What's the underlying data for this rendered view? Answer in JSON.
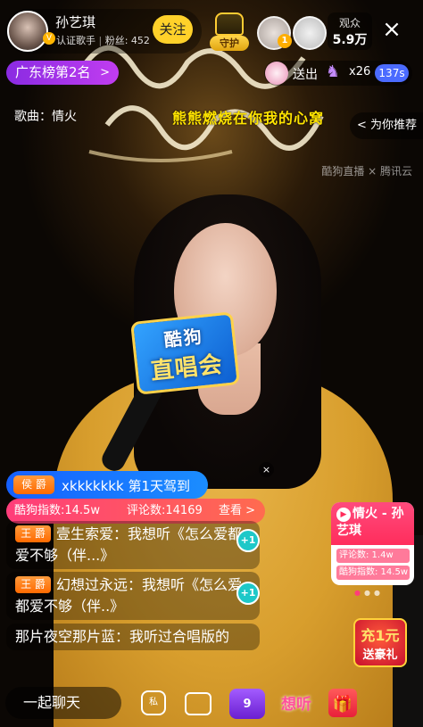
{
  "anchor": {
    "name": "孙艺琪",
    "title": "认证歌手",
    "fans": "粉丝: 452",
    "follow_label": "关注",
    "verified_badge": "V"
  },
  "guard": {
    "label": "守护"
  },
  "fan_rank": {
    "top_rank": "1"
  },
  "viewers": {
    "label": "观众",
    "count": "5.9万"
  },
  "close_icon": "×",
  "rank_badge": {
    "label": "广东榜第2名",
    "arrow": ">"
  },
  "gift_bar": {
    "send_label": "送出",
    "count": "x26",
    "timer": "137s"
  },
  "song": {
    "label": "歌曲：情火",
    "lyric": "熊熊燃烧在你我的心窝"
  },
  "recommend": {
    "label": "< 为你推荐"
  },
  "watermark": "酷狗直播 × 腾讯云",
  "mic_flag": {
    "line1": "酷狗",
    "line2": "直唱会"
  },
  "entry_banner": {
    "tag": "侯 爵",
    "text": "xkkkkkkk 第1天驾到"
  },
  "song_card": {
    "index_label": "酷狗指数:14.5w",
    "comments_label": "评论数:14169",
    "view_label": "查看 >",
    "close_label": "×"
  },
  "chat": [
    {
      "tag": "王 爵",
      "text": "壹生索爱：我想听《怎么爱都爱不够（伴...》"
    },
    {
      "tag": "王 爵",
      "text": "幻想过永远：我想听《怎么爱都爱不够（伴..》"
    },
    {
      "tag": "",
      "text": "那片夜空那片蓝：我听过合唱版的"
    }
  ],
  "plus_one_label": "+1",
  "side_card": {
    "title": "情火 - 孙艺琪",
    "comments": "评论数: 1.4w",
    "index": "酷狗指数: 14.5w"
  },
  "promo": {
    "top": "充1元",
    "bottom": "送豪礼"
  },
  "bottom_bar": {
    "chat_label": "一起聊天",
    "private_label": "私",
    "vip_label": "9",
    "want_label": "想听",
    "gift_icon": "🎁"
  },
  "colors": {
    "follow_yellow": "#ffd12a",
    "rank_purple": "#8a2be2",
    "lyric_yellow": "#ffe400",
    "entry_blue": "#1560ff",
    "song_card_pink": "#ff3d7a",
    "timer_blue": "#4b6bff"
  },
  "icons": [
    "close-icon",
    "gift-icon",
    "private-message-icon",
    "video-icon",
    "vip-icon",
    "want-listen-icon",
    "gift-box-icon",
    "play-icon",
    "crown-icon"
  ]
}
